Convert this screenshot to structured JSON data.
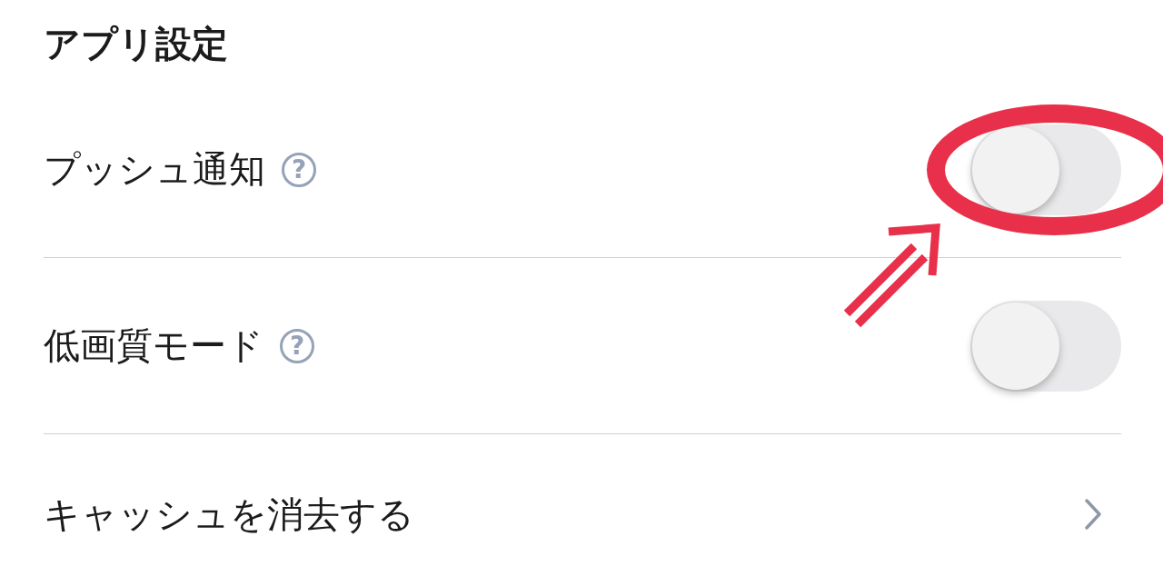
{
  "title": "アプリ設定",
  "settings": [
    {
      "kind": "toggle",
      "label": "プッシュ通知",
      "help": "?",
      "on": false,
      "highlighted": true
    },
    {
      "kind": "toggle",
      "label": "低画質モード",
      "help": "?",
      "on": false,
      "highlighted": false
    },
    {
      "kind": "link",
      "label": "キャッシュを消去する"
    }
  ]
}
